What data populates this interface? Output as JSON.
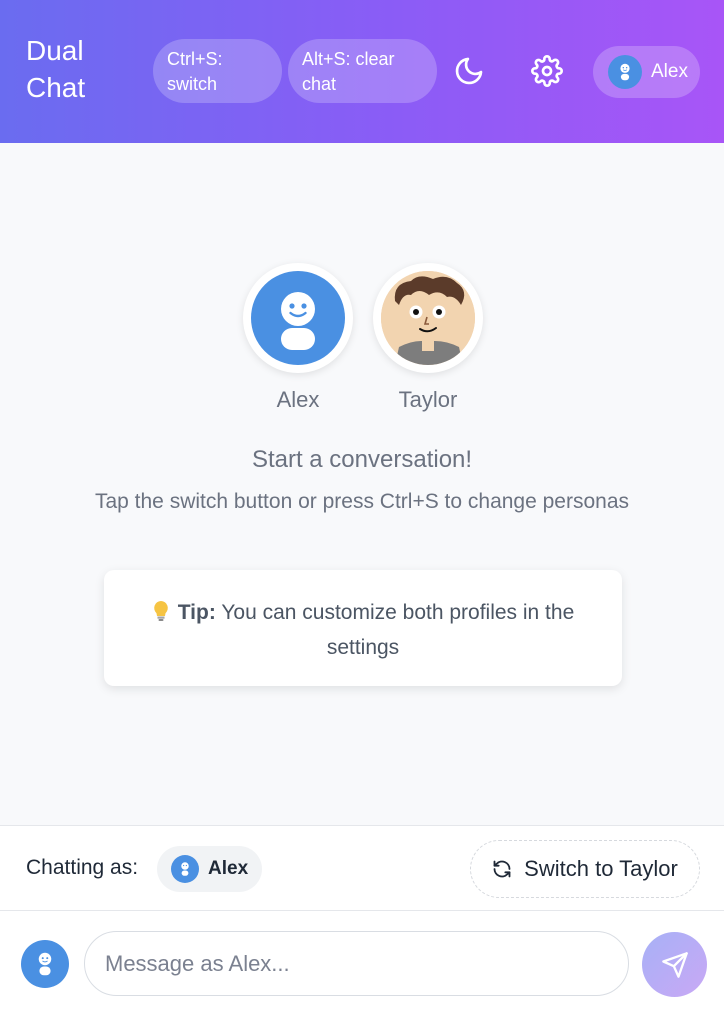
{
  "header": {
    "title": "Dual Chat",
    "shortcut_switch": "Ctrl+S: switch",
    "shortcut_clear": "Alt+S: clear chat",
    "theme_icon": "moon-icon",
    "settings_icon": "gear-icon",
    "current_user": "Alex"
  },
  "empty_state": {
    "personas": [
      {
        "name": "Alex",
        "avatar": "robot-avatar-icon",
        "color": "#4a90e2"
      },
      {
        "name": "Taylor",
        "avatar": "cartoon-face-avatar",
        "color": "#f2d4b0"
      }
    ],
    "title": "Start a conversation!",
    "subtitle": "Tap the switch button or press Ctrl+S to change personas",
    "tip_icon": "lightbulb-icon",
    "tip_label": "Tip:",
    "tip_text": "You can customize both profiles in the settings"
  },
  "persona_bar": {
    "chatting_label": "Chatting as:",
    "current_persona": "Alex",
    "switch_label": "Switch to Taylor",
    "switch_icon": "refresh-icon"
  },
  "composer": {
    "placeholder": "Message as Alex...",
    "value": "",
    "send_icon": "send-icon"
  },
  "colors": {
    "header_gradient_start": "#6a6cf0",
    "header_gradient_end": "#a855f7",
    "alex_avatar": "#4a90e2",
    "send_button": "#b7abf5"
  }
}
